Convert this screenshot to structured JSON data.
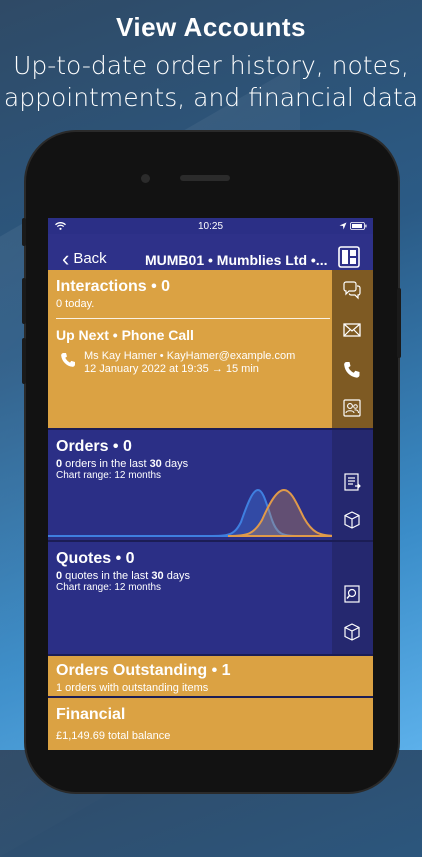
{
  "promo": {
    "title": "View Accounts",
    "subtitle_line1": "Up-to-date order history, notes,",
    "subtitle_line2": "appointments, and financial data"
  },
  "status_bar": {
    "time": "10:25"
  },
  "nav": {
    "back_label": "Back",
    "title": "MUMB01 • Mumblies Ltd •..."
  },
  "interactions": {
    "title": "Interactions • 0",
    "subtitle": "0 today.",
    "up_next_title": "Up Next • Phone Call",
    "contact_line": "Ms Kay Hamer • KayHamer@example.com",
    "time_line": "12 January 2022 at 19:35 → 15 min",
    "rail_icons": [
      "chat-icon",
      "mail-icon",
      "phone-icon",
      "contacts-icon"
    ]
  },
  "orders": {
    "title": "Orders • 0",
    "count": "0",
    "count_text_a": " orders in the last ",
    "days": "30",
    "count_text_b": " days",
    "range": "Chart range: 12 months",
    "rail_icons": [
      "order-list-icon",
      "box-icon"
    ],
    "colors": {
      "series_a": "#3f7fe0",
      "series_b": "#e09a4a"
    }
  },
  "quotes": {
    "title": "Quotes • 0",
    "count": "0",
    "count_text_a": " quotes in the last ",
    "days": "30",
    "count_text_b": " days",
    "range": "Chart range: 12 months",
    "rail_icons": [
      "quote-search-icon",
      "box-icon"
    ]
  },
  "outstanding": {
    "title": "Orders Outstanding • 1",
    "subtitle": "1 orders with outstanding items"
  },
  "financial": {
    "title": "Financial",
    "subtitle": "£1,149.69 total balance"
  },
  "colors": {
    "orange": "#dba243",
    "navy": "#2b2f86",
    "nav_bar": "#2e3189"
  }
}
